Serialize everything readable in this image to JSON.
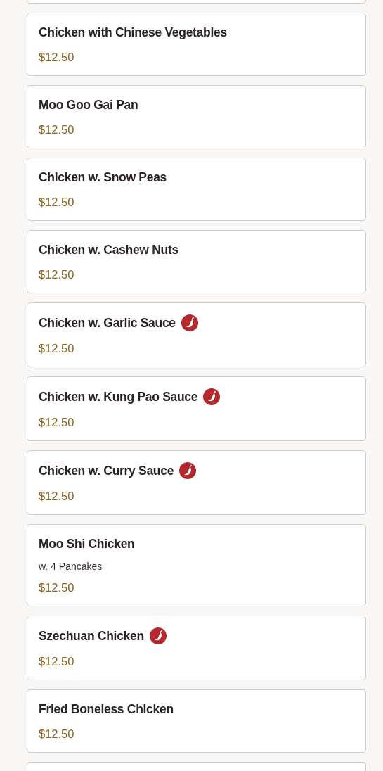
{
  "menu_items": [
    {
      "name": "Chicken with Chinese Vegetables",
      "spicy": false,
      "price": "$12.50"
    },
    {
      "name": "Moo Goo Gai Pan",
      "spicy": false,
      "price": "$12.50"
    },
    {
      "name": "Chicken w. Snow Peas",
      "spicy": false,
      "price": "$12.50"
    },
    {
      "name": "Chicken w. Cashew Nuts",
      "spicy": false,
      "price": "$12.50"
    },
    {
      "name": "Chicken w. Garlic Sauce",
      "spicy": true,
      "price": "$12.50"
    },
    {
      "name": "Chicken w. Kung Pao Sauce",
      "spicy": true,
      "price": "$12.50"
    },
    {
      "name": "Chicken w. Curry Sauce",
      "spicy": true,
      "price": "$12.50"
    },
    {
      "name": "Moo Shi Chicken",
      "spicy": false,
      "note": "w. 4 Pancakes",
      "price": "$12.50"
    },
    {
      "name": "Szechuan Chicken",
      "spicy": true,
      "price": "$12.50"
    },
    {
      "name": "Fried Boneless Chicken",
      "spicy": false,
      "price": "$12.50"
    }
  ]
}
